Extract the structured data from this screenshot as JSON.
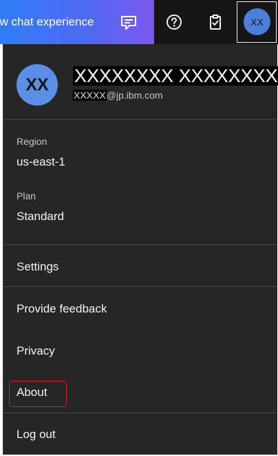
{
  "header": {
    "promo_text": "ew chat experience",
    "promo_icon": "chat-feedback-icon",
    "help_icon": "help-icon",
    "checklist_icon": "clipboard-check-icon",
    "avatar_initials": "XX"
  },
  "profile": {
    "initials": "XX",
    "name": "XXXXXXXX XXXXXXXXX",
    "email_user": "XXXXX",
    "email_domain": "@jp.ibm.com"
  },
  "account": {
    "region_label": "Region",
    "region_value": "us-east-1",
    "plan_label": "Plan",
    "plan_value": "Standard"
  },
  "menu": {
    "settings": "Settings",
    "feedback": "Provide feedback",
    "privacy": "Privacy",
    "about": "About",
    "logout": "Log out"
  },
  "colors": {
    "panel_bg": "#262626",
    "avatar_blue": "#5b8ee6",
    "highlight": "#da1e28"
  }
}
